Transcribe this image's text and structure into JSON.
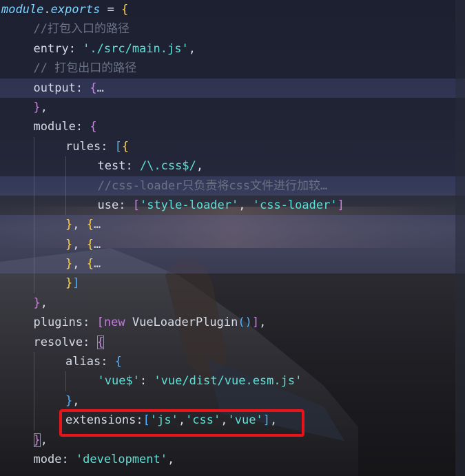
{
  "lines": [
    {
      "indent": 0,
      "guides": [],
      "hl": false,
      "tokens": [
        [
          "module",
          [
            "kw",
            "it"
          ]
        ],
        [
          ".",
          [
            "punc"
          ]
        ],
        [
          "exports",
          [
            "kw",
            "it"
          ]
        ],
        [
          " = ",
          [
            "punc"
          ]
        ],
        [
          "{",
          [
            "b1"
          ]
        ]
      ]
    },
    {
      "indent": 1,
      "guides": [],
      "hl": false,
      "tokens": [
        [
          "//打包入口的路径",
          [
            "com"
          ]
        ]
      ]
    },
    {
      "indent": 1,
      "guides": [],
      "hl": false,
      "tokens": [
        [
          "entry",
          [
            "prop"
          ]
        ],
        [
          ": ",
          [
            "punc"
          ]
        ],
        [
          "'./src/main.js'",
          [
            "str"
          ]
        ],
        [
          ",",
          [
            "punc"
          ]
        ]
      ]
    },
    {
      "indent": 1,
      "guides": [],
      "hl": false,
      "tokens": [
        [
          "// 打包出口的路径",
          [
            "com"
          ]
        ]
      ]
    },
    {
      "indent": 1,
      "guides": [],
      "hl": true,
      "tokens": [
        [
          "output",
          [
            "prop"
          ]
        ],
        [
          ": ",
          [
            "punc"
          ]
        ],
        [
          "{",
          [
            "b2"
          ]
        ],
        [
          "…",
          [
            "fold"
          ]
        ]
      ]
    },
    {
      "indent": 1,
      "guides": [],
      "hl": false,
      "tokens": [
        [
          "}",
          [
            "b2"
          ]
        ],
        [
          ",",
          [
            "punc"
          ]
        ]
      ]
    },
    {
      "indent": 1,
      "guides": [],
      "hl": false,
      "tokens": [
        [
          "module",
          [
            "prop"
          ]
        ],
        [
          ": ",
          [
            "punc"
          ]
        ],
        [
          "{",
          [
            "b2"
          ]
        ]
      ]
    },
    {
      "indent": 2,
      "guides": [
        1
      ],
      "hl": false,
      "tokens": [
        [
          "rules",
          [
            "prop"
          ]
        ],
        [
          ": ",
          [
            "punc"
          ]
        ],
        [
          "[",
          [
            "b3"
          ]
        ],
        [
          "{",
          [
            "b1"
          ]
        ]
      ]
    },
    {
      "indent": 3,
      "guides": [
        1,
        2
      ],
      "hl": false,
      "tokens": [
        [
          "test",
          [
            "prop"
          ]
        ],
        [
          ": ",
          [
            "punc"
          ]
        ],
        [
          "/\\.css$/",
          [
            "str"
          ]
        ],
        [
          ",",
          [
            "punc"
          ]
        ]
      ]
    },
    {
      "indent": 3,
      "guides": [
        1,
        2
      ],
      "hl": true,
      "tokens": [
        [
          "//css-loader只负责将css文件进行加较…",
          [
            "com"
          ]
        ]
      ]
    },
    {
      "indent": 3,
      "guides": [
        1,
        2
      ],
      "hl": false,
      "tokens": [
        [
          "use",
          [
            "prop"
          ]
        ],
        [
          ": ",
          [
            "punc"
          ]
        ],
        [
          "[",
          [
            "b2"
          ]
        ],
        [
          "'style-loader'",
          [
            "str"
          ]
        ],
        [
          ", ",
          [
            "punc"
          ]
        ],
        [
          "'css-loader'",
          [
            "str"
          ]
        ],
        [
          "]",
          [
            "b2"
          ]
        ]
      ]
    },
    {
      "indent": 2,
      "guides": [
        1
      ],
      "hl": true,
      "tokens": [
        [
          "}",
          [
            "b1"
          ]
        ],
        [
          ", ",
          [
            "punc"
          ]
        ],
        [
          "{",
          [
            "b1"
          ]
        ],
        [
          "…",
          [
            "fold"
          ]
        ]
      ]
    },
    {
      "indent": 2,
      "guides": [
        1
      ],
      "hl": true,
      "tokens": [
        [
          "}",
          [
            "b1"
          ]
        ],
        [
          ", ",
          [
            "punc"
          ]
        ],
        [
          "{",
          [
            "b1"
          ]
        ],
        [
          "…",
          [
            "fold"
          ]
        ]
      ]
    },
    {
      "indent": 2,
      "guides": [
        1
      ],
      "hl": true,
      "tokens": [
        [
          "}",
          [
            "b1"
          ]
        ],
        [
          ", ",
          [
            "punc"
          ]
        ],
        [
          "{",
          [
            "b1"
          ]
        ],
        [
          "…",
          [
            "fold"
          ]
        ]
      ]
    },
    {
      "indent": 2,
      "guides": [
        1
      ],
      "hl": false,
      "tokens": [
        [
          "}",
          [
            "b1"
          ]
        ],
        [
          "]",
          [
            "b3"
          ]
        ]
      ]
    },
    {
      "indent": 1,
      "guides": [],
      "hl": false,
      "tokens": [
        [
          "}",
          [
            "b2"
          ]
        ],
        [
          ",",
          [
            "punc"
          ]
        ]
      ]
    },
    {
      "indent": 1,
      "guides": [],
      "hl": false,
      "tokens": [
        [
          "plugins",
          [
            "prop"
          ]
        ],
        [
          ": ",
          [
            "punc"
          ]
        ],
        [
          "[",
          [
            "b2"
          ]
        ],
        [
          "new ",
          [
            "newk"
          ]
        ],
        [
          "VueLoaderPlugin",
          [
            "ctor"
          ]
        ],
        [
          "()",
          [
            "b3"
          ]
        ],
        [
          "]",
          [
            "b2"
          ]
        ],
        [
          ",",
          [
            "punc"
          ]
        ]
      ]
    },
    {
      "indent": 1,
      "guides": [],
      "hl": false,
      "tokens": [
        [
          "resolve",
          [
            "prop"
          ]
        ],
        [
          ": ",
          [
            "punc"
          ]
        ],
        [
          "{",
          [
            "b2",
            "caret"
          ]
        ]
      ]
    },
    {
      "indent": 2,
      "guides": [
        1
      ],
      "red": [
        1
      ],
      "hl": false,
      "tokens": [
        [
          "alias",
          [
            "prop"
          ]
        ],
        [
          ": ",
          [
            "punc"
          ]
        ],
        [
          "{",
          [
            "b3"
          ]
        ]
      ]
    },
    {
      "indent": 3,
      "guides": [
        1,
        2
      ],
      "red": [
        1
      ],
      "hl": false,
      "tokens": [
        [
          "'vue$'",
          [
            "str"
          ]
        ],
        [
          ": ",
          [
            "punc"
          ]
        ],
        [
          "'vue/dist/vue.esm.js'",
          [
            "str"
          ]
        ]
      ]
    },
    {
      "indent": 2,
      "guides": [
        1
      ],
      "red": [
        1
      ],
      "hl": false,
      "tokens": [
        [
          "}",
          [
            "b3"
          ]
        ],
        [
          ",",
          [
            "punc"
          ]
        ]
      ]
    },
    {
      "indent": 2,
      "guides": [
        1
      ],
      "red": [
        1
      ],
      "hl": false,
      "tokens": [
        [
          "extensions",
          [
            "prop"
          ]
        ],
        [
          ":",
          [
            "punc"
          ]
        ],
        [
          "[",
          [
            "b3"
          ]
        ],
        [
          "'js'",
          [
            "str"
          ]
        ],
        [
          ",",
          [
            "punc"
          ]
        ],
        [
          "'css'",
          [
            "str"
          ]
        ],
        [
          ",",
          [
            "punc"
          ]
        ],
        [
          "'vue'",
          [
            "str"
          ]
        ],
        [
          "]",
          [
            "b3"
          ]
        ],
        [
          ",",
          [
            "punc"
          ]
        ]
      ]
    },
    {
      "indent": 1,
      "guides": [],
      "hl": false,
      "tokens": [
        [
          "}",
          [
            "b2",
            "caret"
          ]
        ],
        [
          ",",
          [
            "punc"
          ]
        ]
      ]
    },
    {
      "indent": 1,
      "guides": [],
      "hl": false,
      "tokens": [
        [
          "mode",
          [
            "prop"
          ]
        ],
        [
          ": ",
          [
            "punc"
          ]
        ],
        [
          "'development'",
          [
            "str"
          ]
        ],
        [
          ",",
          [
            "punc"
          ]
        ]
      ]
    }
  ]
}
